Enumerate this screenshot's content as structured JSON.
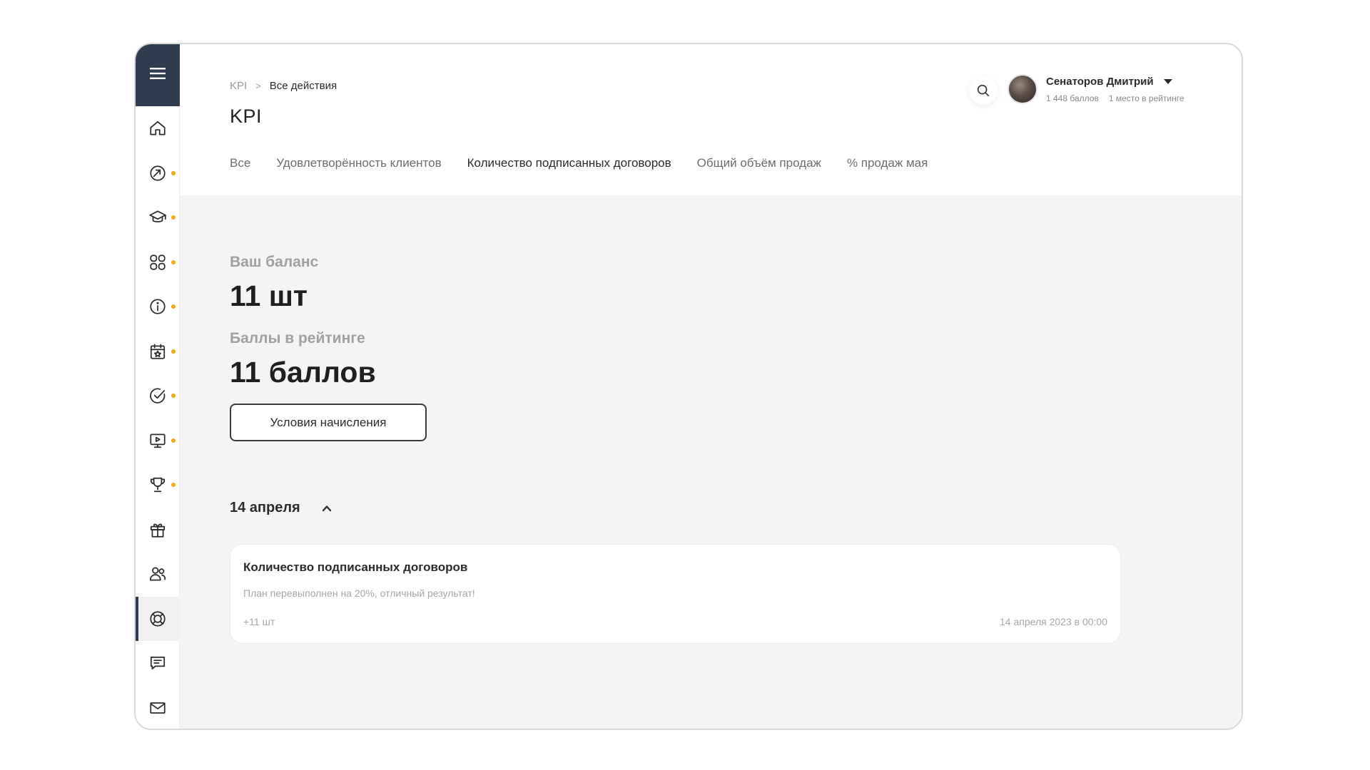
{
  "breadcrumb": {
    "root": "KPI",
    "separator": ">",
    "current": "Все действия"
  },
  "page": {
    "title": "KPI"
  },
  "tabs": [
    {
      "label": "Все",
      "active": false
    },
    {
      "label": "Удовлетворённость клиентов",
      "active": false
    },
    {
      "label": "Количество подписанных договоров",
      "active": true
    },
    {
      "label": "Общий объём продаж",
      "active": false
    },
    {
      "label": "% продаж мая",
      "active": false
    }
  ],
  "user": {
    "name": "Сенаторов Дмитрий",
    "points": "1 448 баллов",
    "rank": "1 место в рейтинге"
  },
  "balance": {
    "label": "Ваш баланс",
    "value": "11 шт",
    "rating_label": "Баллы в рейтинге",
    "rating_value": "11 баллов",
    "conditions_button": "Условия начисления"
  },
  "activity": {
    "date_group": "14 апреля",
    "items": [
      {
        "title": "Количество подписанных договоров",
        "description": "План перевыполнен на 20%, отличный результат!",
        "amount": "+11 шт",
        "date": "14 апреля 2023 в 00:00"
      }
    ]
  },
  "sidebar": {
    "items": [
      {
        "icon": "home-icon",
        "badge": false
      },
      {
        "icon": "growth-arrow-icon",
        "badge": true
      },
      {
        "icon": "graduation-cap-icon",
        "badge": true
      },
      {
        "icon": "apps-grid-icon",
        "badge": true
      },
      {
        "icon": "info-icon",
        "badge": true
      },
      {
        "icon": "calendar-star-icon",
        "badge": true
      },
      {
        "icon": "check-circle-icon",
        "badge": true
      },
      {
        "icon": "video-screen-icon",
        "badge": true
      },
      {
        "icon": "trophy-icon",
        "badge": true
      },
      {
        "icon": "gift-icon",
        "badge": false
      },
      {
        "icon": "users-icon",
        "badge": false
      },
      {
        "icon": "kpi-target-icon",
        "badge": false,
        "active": true
      },
      {
        "icon": "chat-icon",
        "badge": false
      },
      {
        "icon": "mail-icon",
        "badge": false
      }
    ]
  },
  "colors": {
    "sidebar_header": "#2f3c4f",
    "badge_dot": "#f3a712",
    "content_bg": "#f4f4f4"
  }
}
